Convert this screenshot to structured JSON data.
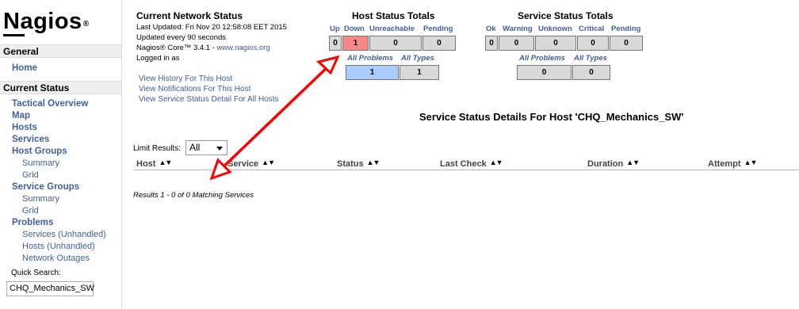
{
  "brand": {
    "name": "Nagios",
    "reg": "®"
  },
  "sidebar": {
    "general_title": "General",
    "home": "Home",
    "current_title": "Current Status",
    "tactical": "Tactical Overview",
    "map": "Map",
    "hosts": "Hosts",
    "services": "Services",
    "host_groups": "Host Groups",
    "hg_summary": "Summary",
    "hg_grid": "Grid",
    "service_groups": "Service Groups",
    "sg_summary": "Summary",
    "sg_grid": "Grid",
    "problems": "Problems",
    "prob_services": "Services",
    "prob_hosts": "Hosts",
    "unhandled": "Unhandled",
    "network_outages": "Network Outages",
    "quick_search_label": "Quick Search:",
    "quick_search_value": "CHQ_Mechanics_SW"
  },
  "info": {
    "title": "Current Network Status",
    "last_updated": "Last Updated: Fri Nov 20 12:58:08 EET 2015",
    "update_interval": "Updated every 90 seconds",
    "version_prefix": "Nagios® Core™ 3.4.1 - ",
    "version_link": "www.nagios.org",
    "logged_in": "Logged in as",
    "link_history": "View History For This Host",
    "link_notifications": "View Notifications For This Host",
    "link_service_detail": "View Service Status Detail For All Hosts"
  },
  "host_totals": {
    "title": "Host Status Totals",
    "headers": [
      "Up",
      "Down",
      "Unreachable",
      "Pending"
    ],
    "values": [
      "0",
      "1",
      "0",
      "0"
    ],
    "sub_headers": [
      "All Problems",
      "All Types"
    ],
    "sub_values": [
      "1",
      "1"
    ]
  },
  "service_totals": {
    "title": "Service Status Totals",
    "headers": [
      "Ok",
      "Warning",
      "Unknown",
      "Critical",
      "Pending"
    ],
    "values": [
      "0",
      "0",
      "0",
      "0",
      "0"
    ],
    "sub_headers": [
      "All Problems",
      "All Types"
    ],
    "sub_values": [
      "0",
      "0"
    ]
  },
  "main": {
    "title": "Service Status Details For Host 'CHQ_Mechanics_SW'",
    "limit_label": "Limit Results:",
    "limit_value": "All",
    "columns": [
      "Host",
      "Service",
      "Status",
      "Last Check",
      "Duration",
      "Attempt"
    ],
    "results_text": "Results 1 - 0 of 0 Matching Services"
  },
  "colors": {
    "link": "#3f5f9f",
    "down_cell": "#f88888",
    "problem_cell": "#aaccff",
    "neutral_cell": "#d9d9d9",
    "annotation": "#ff0000"
  },
  "icons": {
    "sort": "sort-arrows-icon",
    "select_caret": "chevron-down-icon",
    "annotation": "double-headed-arrow-icon"
  }
}
